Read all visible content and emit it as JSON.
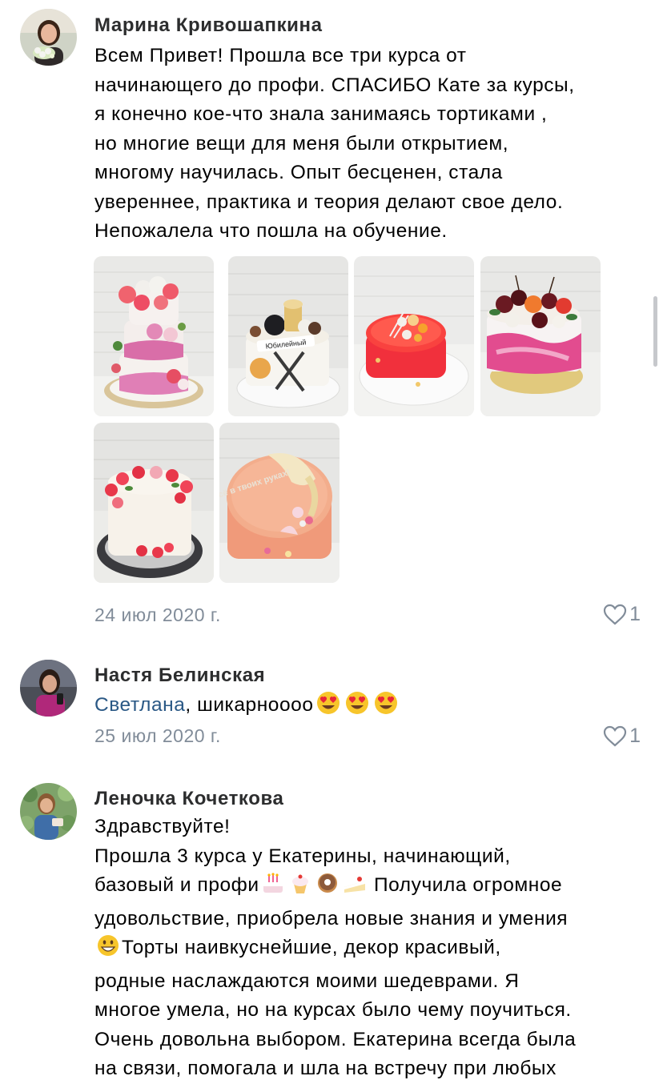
{
  "comments": [
    {
      "author": "Марина Кривошапкина",
      "lines": [
        "Всем Привет! Прошла все три курса от",
        "начинающего до профи. СПАСИБО Кате за курсы,",
        "я конечно кое-что знала занимаясь тортиками ,",
        "но многие вещи для меня были открытием,",
        "многому научилась. Опыт бесценен, стала",
        "увереннее, практика и теория делают свое дело.",
        "Непожалела что пошла на обучение."
      ],
      "photos": [
        {
          "icon": "cake-photo-tiered-flowers"
        },
        {
          "icon": "cake-photo-hockey",
          "inscription": "Юбилейный"
        },
        {
          "icon": "cake-photo-red-glaze"
        },
        {
          "icon": "cake-photo-cherries"
        },
        {
          "icon": "cake-photo-strawberries"
        },
        {
          "icon": "cake-photo-inscription",
          "inscription": "Всё в твоих руках!"
        }
      ],
      "date": "24 июл 2020 г.",
      "likes": "1"
    },
    {
      "author": "Настя Белинская",
      "mention": "Светлана",
      "text": ", шикарноооо",
      "emojis": [
        "heart-eyes-emoji",
        "heart-eyes-emoji",
        "heart-eyes-emoji"
      ],
      "date": "25 июл 2020 г.",
      "likes": "1"
    },
    {
      "author": "Леночка Кочеткова",
      "line1": "Здравствуйте!",
      "line2": "Прошла 3 курса у Екатерины, начинающий,",
      "line3a": "базовый и профи",
      "line3b": " Получила огромное",
      "line4": "удовольствие, приобрела новые знания и умения",
      "line5": "Торты наивкуснейшие, декор красивый,",
      "line6": "родные наслаждаются моими шедеврами. Я",
      "line7": "многое умела, но на курсах было чему поучиться.",
      "line8": "Очень довольна выбором. Екатерина всегда была",
      "line9": "на связи, помогала и шла на встречу при любых",
      "emojis_line3": [
        "birthday-cake-emoji",
        "cupcake-emoji",
        "doughnut-emoji",
        "shortcake-emoji"
      ],
      "emoji_line5": "grinning-face-emoji"
    }
  ],
  "colors": {
    "author": "#2c2d2e",
    "link": "#2a5885",
    "secondary": "#818c99"
  }
}
